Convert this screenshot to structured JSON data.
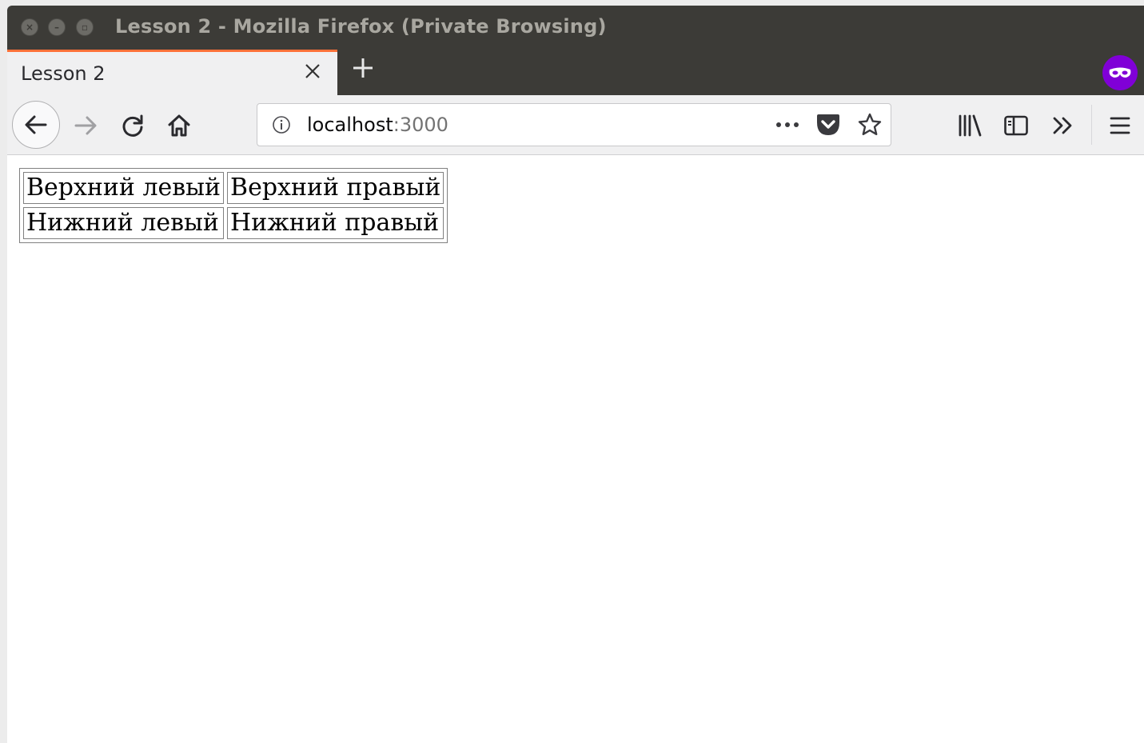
{
  "window": {
    "title": "Lesson 2 - Mozilla Firefox (Private Browsing)"
  },
  "tabs": [
    {
      "label": "Lesson 2",
      "active": true
    }
  ],
  "toolbar": {
    "url_host": "localhost",
    "url_port": ":3000",
    "icons": [
      "back-arrow-icon",
      "forward-arrow-icon",
      "reload-icon",
      "home-icon",
      "info-icon",
      "page-actions-icon",
      "pocket-icon",
      "bookmark-star-icon",
      "library-icon",
      "sidebar-icon",
      "overflow-chevron-icon",
      "hamburger-menu-icon",
      "private-browsing-mask-icon"
    ]
  },
  "colors": {
    "titlebar": "#3c3b37",
    "tab_accent": "#ff7139",
    "private_purple": "#8000d7"
  },
  "content": {
    "table": [
      [
        "Верхний левый",
        "Верхний правый"
      ],
      [
        "Нижний левый",
        "Нижний правый"
      ]
    ]
  }
}
